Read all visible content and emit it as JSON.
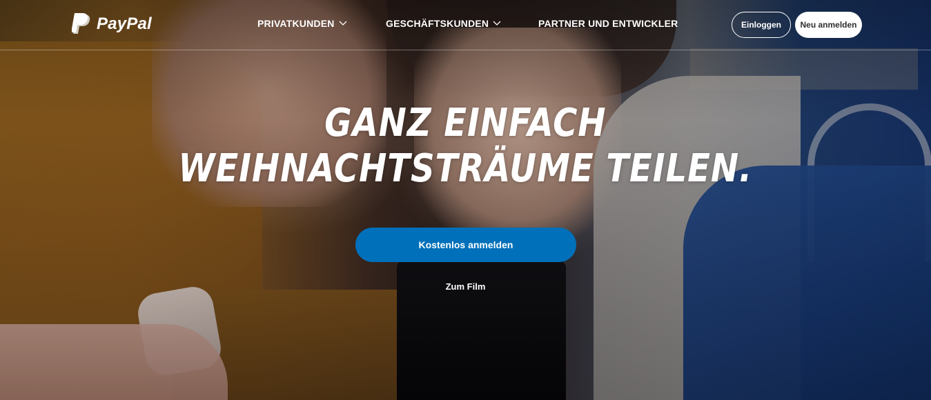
{
  "brand": {
    "name": "PayPal",
    "logo_icon": "paypal-p-icon",
    "primary_color": "#0070ba",
    "text_color": "#ffffff"
  },
  "nav": {
    "items": [
      {
        "label": "PRIVATKUNDEN",
        "has_dropdown": true
      },
      {
        "label": "GESCHÄFTSKUNDEN",
        "has_dropdown": true
      },
      {
        "label": "PARTNER UND ENTWICKLER",
        "has_dropdown": false
      }
    ],
    "login_label": "Einloggen",
    "signup_label": "Neu anmelden"
  },
  "hero": {
    "headline_line1": "GANZ EINFACH",
    "headline_line2": "WEIHNACHTSTRÄUME TEILEN.",
    "cta_label": "Kostenlos anmelden",
    "secondary_link": "Zum Film"
  }
}
